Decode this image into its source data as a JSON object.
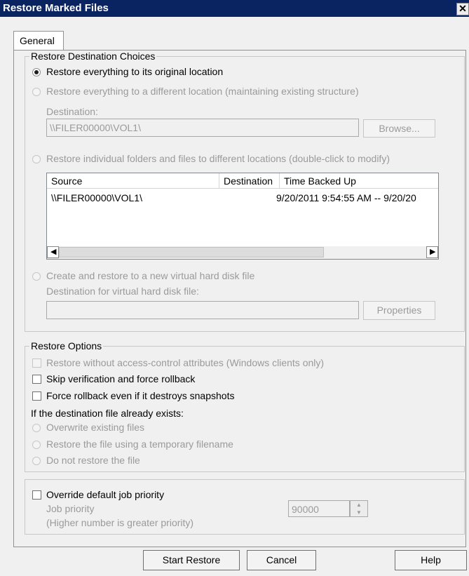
{
  "window": {
    "title": "Restore Marked Files",
    "close_glyph": "✕"
  },
  "tabs": [
    {
      "label": "General"
    }
  ],
  "destination_group": {
    "legend": "Restore Destination Choices",
    "options": [
      {
        "label": "Restore everything to its original location",
        "selected": true,
        "enabled": true
      },
      {
        "label": "Restore everything to a different location (maintaining existing structure)",
        "selected": false,
        "enabled": false
      },
      {
        "label": "Restore individual folders and files to different locations (double-click to modify)",
        "selected": false,
        "enabled": false
      },
      {
        "label": "Create and restore to a new virtual hard disk file",
        "selected": false,
        "enabled": false
      }
    ],
    "destination_label": "Destination:",
    "destination_value": "\\\\FILER00000\\VOL1\\",
    "browse_label": "Browse...",
    "table": {
      "columns": [
        "Source",
        "Destination",
        "Time Backed Up"
      ],
      "rows": [
        [
          "\\\\FILER00000\\VOL1\\",
          "",
          "9/20/2011 9:54:55 AM -- 9/20/20"
        ]
      ]
    },
    "vhd_label": "Destination for virtual hard disk file:",
    "vhd_value": "",
    "properties_label": "Properties"
  },
  "options_group": {
    "legend": "Restore Options",
    "checks": [
      {
        "label": "Restore without access-control attributes (Windows clients only)",
        "checked": false,
        "enabled": false
      },
      {
        "label": "Skip verification and force rollback",
        "checked": false,
        "enabled": true
      },
      {
        "label": "Force rollback even if it destroys snapshots",
        "checked": false,
        "enabled": true
      }
    ],
    "exists_label": "If the destination file already exists:",
    "exists_options": [
      {
        "label": "Overwrite existing files",
        "selected": false,
        "enabled": false
      },
      {
        "label": "Restore the file using a temporary filename",
        "selected": false,
        "enabled": false
      },
      {
        "label": "Do not restore the file",
        "selected": false,
        "enabled": false
      }
    ]
  },
  "priority_group": {
    "override_label": "Override default job priority",
    "override_checked": false,
    "job_priority_label": "Job priority",
    "job_priority_hint": "(Higher number is greater priority)",
    "job_priority_value": "90000"
  },
  "footer": {
    "start_label": "Start Restore",
    "cancel_label": "Cancel",
    "help_label": "Help"
  }
}
